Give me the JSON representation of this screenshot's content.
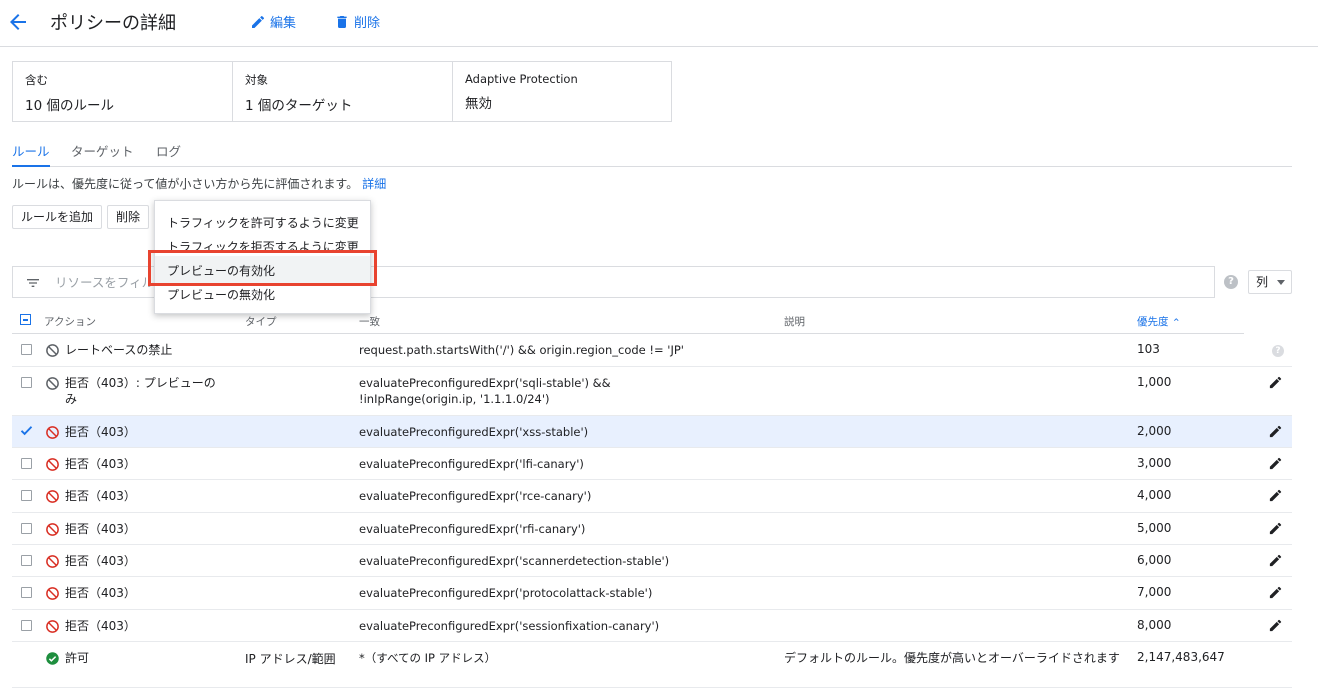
{
  "header": {
    "title": "ポリシーの詳細",
    "edit_label": "編集",
    "delete_label": "削除"
  },
  "summary": {
    "includes_label": "含む",
    "includes_value": "10 個のルール",
    "targets_label": "対象",
    "targets_value": "1 個のターゲット",
    "adaptive_label": "Adaptive Protection",
    "adaptive_value": "無効"
  },
  "tabs": [
    "ルール",
    "ターゲット",
    "ログ"
  ],
  "info": {
    "text": "ルールは、優先度に従って値が小さい方から先に評価されます。",
    "link": "詳細"
  },
  "toolbar": {
    "add_rule": "ルールを追加",
    "delete": "削除"
  },
  "dropdown_menu": {
    "items": [
      "トラフィックを許可するように変更",
      "トラフィックを拒否するように変更",
      "プレビューの有効化",
      "プレビューの無効化"
    ],
    "highlighted": "プレビューの有効化"
  },
  "filter": {
    "placeholder": "リソースをフィルタ",
    "columns_button": "列"
  },
  "table": {
    "headers": {
      "action": "アクション",
      "type": "タイプ",
      "match": "一致",
      "description": "説明",
      "priority": "優先度"
    },
    "rows": [
      {
        "action": "レートベースの禁止",
        "type": "",
        "match": "request.path.startsWith('/') && origin.region_code != 'JP'",
        "description": "",
        "priority": "103",
        "icon": "ban-gray-icon",
        "checked": false
      },
      {
        "action": "拒否（403）: プレビューのみ",
        "type": "",
        "match": "evaluatePreconfiguredExpr('sqli-stable') && !inIpRange(origin.ip, '1.1.1.0/24')",
        "description": "",
        "priority": "1,000",
        "icon": "ban-gray-icon",
        "checked": false
      },
      {
        "action": "拒否（403）",
        "type": "",
        "match": "evaluatePreconfiguredExpr('xss-stable')",
        "description": "",
        "priority": "2,000",
        "icon": "ban-red-icon",
        "checked": true
      },
      {
        "action": "拒否（403）",
        "type": "",
        "match": "evaluatePreconfiguredExpr('lfi-canary')",
        "description": "",
        "priority": "3,000",
        "icon": "ban-red-icon",
        "checked": false
      },
      {
        "action": "拒否（403）",
        "type": "",
        "match": "evaluatePreconfiguredExpr('rce-canary')",
        "description": "",
        "priority": "4,000",
        "icon": "ban-red-icon",
        "checked": false
      },
      {
        "action": "拒否（403）",
        "type": "",
        "match": "evaluatePreconfiguredExpr('rfi-canary')",
        "description": "",
        "priority": "5,000",
        "icon": "ban-red-icon",
        "checked": false
      },
      {
        "action": "拒否（403）",
        "type": "",
        "match": "evaluatePreconfiguredExpr('scannerdetection-stable')",
        "description": "",
        "priority": "6,000",
        "icon": "ban-red-icon",
        "checked": false
      },
      {
        "action": "拒否（403）",
        "type": "",
        "match": "evaluatePreconfiguredExpr('protocolattack-stable')",
        "description": "",
        "priority": "7,000",
        "icon": "ban-red-icon",
        "checked": false
      },
      {
        "action": "拒否（403）",
        "type": "",
        "match": "evaluatePreconfiguredExpr('sessionfixation-canary')",
        "description": "",
        "priority": "8,000",
        "icon": "ban-red-icon",
        "checked": false
      },
      {
        "action": "許可",
        "type": "IP アドレス/範囲",
        "match": "*（すべての IP アドレス）",
        "description": "デフォルトのルール。優先度が高いとオーバーライドされます",
        "priority": "2,147,483,647",
        "icon": "allow-check-icon",
        "checked": false
      }
    ]
  },
  "colors": {
    "accent": "#1a73e8",
    "deny": "#d93025",
    "allow": "#1e8e3e",
    "highlight_box": "#e8432f"
  }
}
